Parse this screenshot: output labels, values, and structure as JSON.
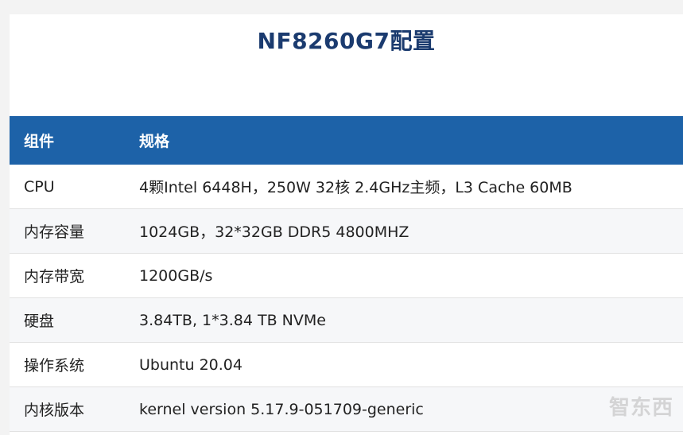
{
  "title": "NF8260G7配置",
  "table": {
    "headers": [
      "组件",
      "规格"
    ],
    "rows": [
      {
        "component": "CPU",
        "spec": "4颗Intel 6448H，250W 32核 2.4GHz主频，L3 Cache 60MB"
      },
      {
        "component": "内存容量",
        "spec": "1024GB，32*32GB DDR5 4800MHZ"
      },
      {
        "component": "内存带宽",
        "spec": "1200GB/s"
      },
      {
        "component": "硬盘",
        "spec": "3.84TB, 1*3.84 TB NVMe"
      },
      {
        "component": "操作系统",
        "spec": "Ubuntu 20.04"
      },
      {
        "component": "内核版本",
        "spec": "kernel version 5.17.9-051709-generic"
      }
    ]
  },
  "watermark": {
    "text": "智东西"
  },
  "colors": {
    "header_bg": "#1d62a8",
    "title": "#1b3b6f"
  }
}
